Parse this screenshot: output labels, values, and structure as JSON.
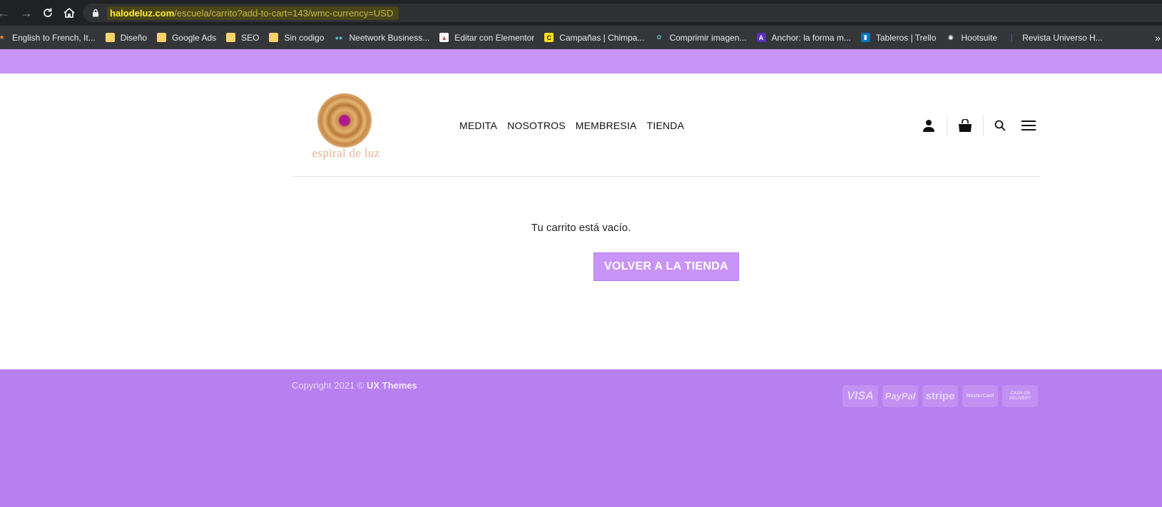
{
  "browser": {
    "url_host": "halodeluz.com",
    "url_path": "/escuela/carrito?add-to-cart=143/wmc-currency=USD",
    "bookmarks": [
      {
        "label": "English to French, It...",
        "icon": "translate-icon"
      },
      {
        "label": "Diseño",
        "icon": "folder-icon"
      },
      {
        "label": "Google Ads",
        "icon": "folder-icon"
      },
      {
        "label": "SEO",
        "icon": "folder-icon"
      },
      {
        "label": "Sin codigo",
        "icon": "folder-icon"
      },
      {
        "label": "Neetwork Business...",
        "icon": "neetwork-icon"
      },
      {
        "label": "Editar con Elementor",
        "icon": "elementor-icon"
      },
      {
        "label": "Campañas | Chimpa...",
        "icon": "mailchimp-icon"
      },
      {
        "label": "Comprimir imagen...",
        "icon": "leaf-icon"
      },
      {
        "label": "Anchor: la forma m...",
        "icon": "anchor-icon"
      },
      {
        "label": "Tableros | Trello",
        "icon": "trello-icon"
      },
      {
        "label": "Hootsuite",
        "icon": "owl-icon"
      },
      {
        "label": "Revista Universo H...",
        "icon": "bookmark-icon"
      }
    ],
    "more_label": "»"
  },
  "site": {
    "logo_text": "espiral de luz",
    "nav": [
      "MEDITA",
      "NOSOTROS",
      "MEMBRESIA",
      "TIENDA"
    ]
  },
  "cart": {
    "empty_message": "Tu carrito está vacío.",
    "return_button": "VOLVER A LA TIENDA"
  },
  "footer": {
    "copyright_prefix": "Copyright 2021 ©",
    "copyright_brand": "UX Themes",
    "payment_methods": [
      "VISA",
      "PayPal",
      "stripe",
      "MasterCard",
      "CASH ON DELIVERY"
    ]
  },
  "colors": {
    "accent": "#c894f7",
    "footer_bg": "#b87ff0",
    "chrome_bg": "#202124"
  }
}
